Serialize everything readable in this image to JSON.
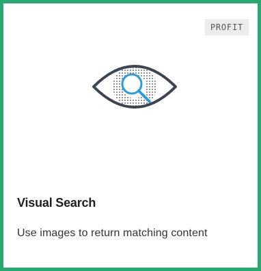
{
  "card": {
    "badge": "PROFIT",
    "title": "Visual Search",
    "description": "Use images to return matching content",
    "icon": "eye-magnifier-icon"
  },
  "colors": {
    "border": "#29a871",
    "icon_outline": "#3c4550",
    "icon_accent": "#2d9cdb",
    "badge_bg": "#ececec"
  }
}
